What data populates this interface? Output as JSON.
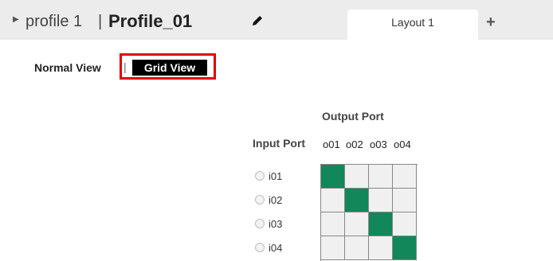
{
  "header": {
    "profile_label": "profile 1",
    "separator": "|",
    "profile_name": "Profile_01",
    "edit_icon": "pencil-icon",
    "tabs": [
      {
        "label": "Layout 1",
        "active": true
      }
    ],
    "add_tab_label": "+"
  },
  "view_toggle": {
    "normal_label": "Normal View",
    "separator": "|",
    "grid_label": "Grid View",
    "selected": "Grid View",
    "highlight_color": "#e00000"
  },
  "matrix": {
    "output_port_label": "Output Port",
    "input_port_label": "Input Port",
    "outputs": [
      "o01",
      "o02",
      "o03",
      "o04"
    ],
    "inputs": [
      "i01",
      "i02",
      "i03",
      "i04"
    ],
    "connections": [
      {
        "input": "i01",
        "output": "o01"
      },
      {
        "input": "i02",
        "output": "o02"
      },
      {
        "input": "i03",
        "output": "o03"
      },
      {
        "input": "i04",
        "output": "o04"
      }
    ],
    "connected_color": "#12875a",
    "empty_color": "#f0f0f0"
  }
}
